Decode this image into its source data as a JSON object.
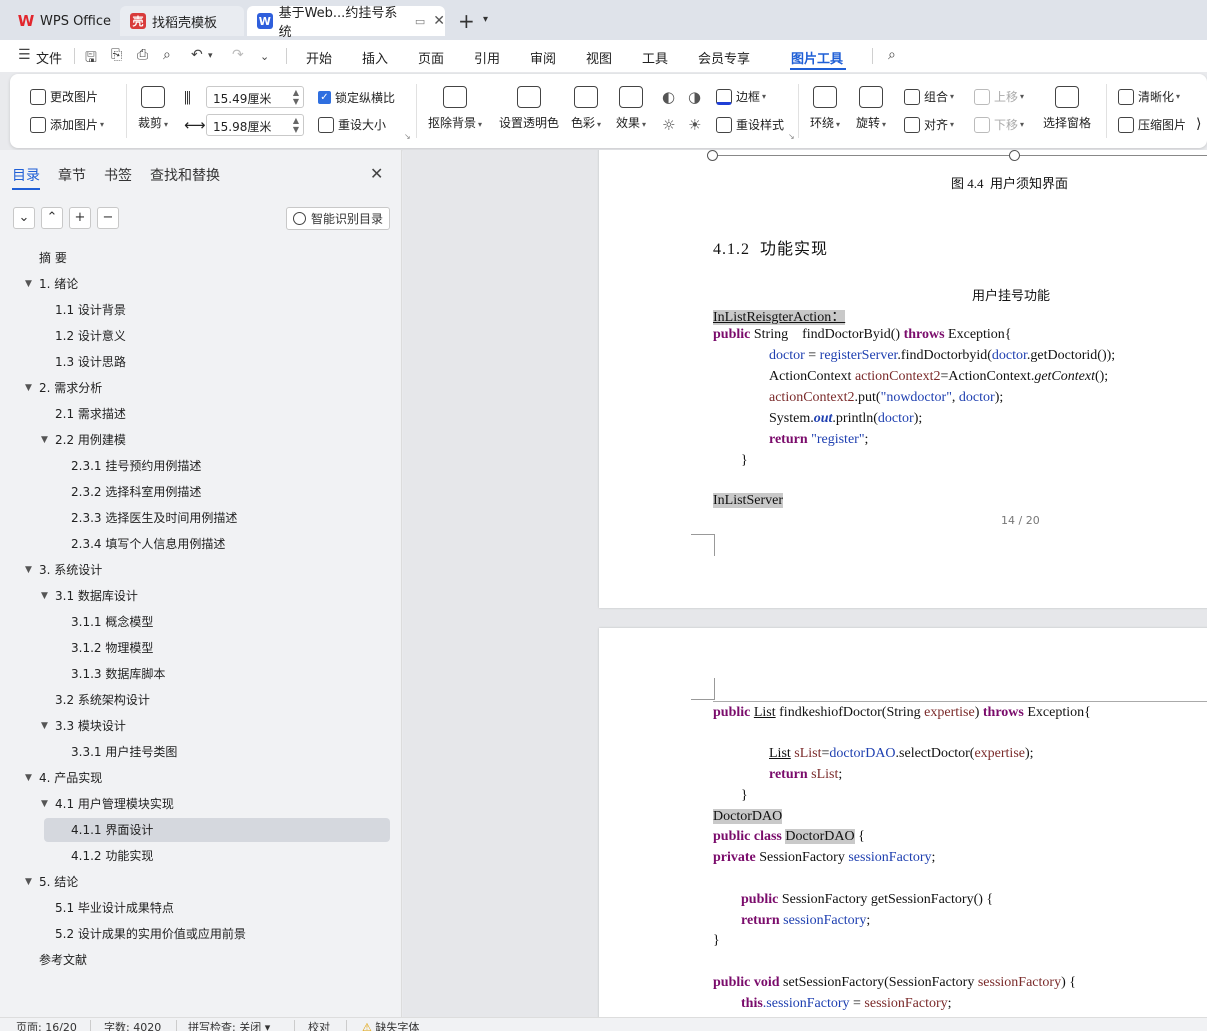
{
  "tabs": {
    "wps": "WPS Office",
    "template": "找稻壳模板",
    "document": "基于Web...约挂号系统"
  },
  "menu": {
    "file": "文件",
    "items": [
      "开始",
      "插入",
      "页面",
      "引用",
      "审阅",
      "视图",
      "工具",
      "会员专享",
      "图片工具"
    ],
    "active": "图片工具"
  },
  "ribbon": {
    "change_image": "更改图片",
    "add_image": "添加图片",
    "crop": "裁剪",
    "width_value": "15.49厘米",
    "height_value": "15.98厘米",
    "lock_ratio": "锁定纵横比",
    "reset_size": "重设大小",
    "remove_bg": "抠除背景",
    "set_transparent": "设置透明色",
    "color": "色彩",
    "effect": "效果",
    "border": "边框",
    "reset_style": "重设样式",
    "wrap": "环绕",
    "rotate": "旋转",
    "group": "组合",
    "align": "对齐",
    "move_up": "上移",
    "move_down": "下移",
    "selection_pane": "选择窗格",
    "sharpen": "清晰化",
    "compress": "压缩图片"
  },
  "nav_panel": {
    "tabs": [
      "目录",
      "章节",
      "书签",
      "查找和替换"
    ],
    "active_tab": "目录",
    "smart_toc": "智能识别目录",
    "toc": [
      {
        "text": "摘  要",
        "level": 0,
        "arrow": false
      },
      {
        "text": "1.  绪论",
        "level": 0,
        "arrow": true
      },
      {
        "text": "1.1 设计背景",
        "level": 1,
        "arrow": false
      },
      {
        "text": "1.2 设计意义",
        "level": 1,
        "arrow": false
      },
      {
        "text": "1.3 设计思路",
        "level": 1,
        "arrow": false
      },
      {
        "text": "2.  需求分析",
        "level": 0,
        "arrow": true
      },
      {
        "text": "2.1  需求描述",
        "level": 1,
        "arrow": false
      },
      {
        "text": "2.2  用例建模",
        "level": 1,
        "arrow": true
      },
      {
        "text": "2.3.1  挂号预约用例描述",
        "level": 2,
        "arrow": false
      },
      {
        "text": "2.3.2 选择科室用例描述",
        "level": 2,
        "arrow": false
      },
      {
        "text": "2.3.3  选择医生及时间用例描述",
        "level": 2,
        "arrow": false
      },
      {
        "text": "2.3.4  填写个人信息用例描述",
        "level": 2,
        "arrow": false
      },
      {
        "text": "3.  系统设计",
        "level": 0,
        "arrow": true
      },
      {
        "text": "3.1  数据库设计",
        "level": 1,
        "arrow": true
      },
      {
        "text": "3.1.1  概念模型",
        "level": 2,
        "arrow": false
      },
      {
        "text": "3.1.2  物理模型",
        "level": 2,
        "arrow": false
      },
      {
        "text": "3.1.3  数据库脚本",
        "level": 2,
        "arrow": false
      },
      {
        "text": "3.2  系统架构设计",
        "level": 1,
        "arrow": false
      },
      {
        "text": "3.3  模块设计",
        "level": 1,
        "arrow": true
      },
      {
        "text": "3.3.1 用户挂号类图",
        "level": 2,
        "arrow": false
      },
      {
        "text": "4.  产品实现",
        "level": 0,
        "arrow": true
      },
      {
        "text": "4.1  用户管理模块实现",
        "level": 1,
        "arrow": true
      },
      {
        "text": "4.1.1  界面设计",
        "level": 2,
        "arrow": false,
        "selected": true
      },
      {
        "text": "4.1.2  功能实现",
        "level": 2,
        "arrow": false
      },
      {
        "text": "5.  结论",
        "level": 0,
        "arrow": true
      },
      {
        "text": "5.1 毕业设计成果特点",
        "level": 1,
        "arrow": false
      },
      {
        "text": "5.2 设计成果的实用价值或应用前景",
        "level": 1,
        "arrow": false
      },
      {
        "text": "参考文献",
        "level": 0,
        "arrow": false
      }
    ]
  },
  "document": {
    "figure_caption": "图 4.4  用户须知界面",
    "section_heading": "4.1.2  功能实现",
    "subtitle": "用户挂号功能",
    "class_label_1": "InListReisgterAction：",
    "code1": {
      "l1_kw": "public",
      "l1_rest": " String    findDoctorByid() ",
      "l1_kw2": "throws",
      "l1_end": " Exception{",
      "l2_a": "doctor",
      "l2_b": " = ",
      "l2_c": "registerServer",
      "l2_d": ".findDoctorbyid(",
      "l2_e": "doctor",
      "l2_f": ".getDoctorid());",
      "l3_a": "ActionContext ",
      "l3_b": "actionContext2",
      "l3_c": "=ActionContext.",
      "l3_d": "getContext",
      "l3_e": "();",
      "l4_a": "actionContext2",
      "l4_b": ".put(",
      "l4_c": "\"nowdoctor\"",
      "l4_d": ", ",
      "l4_e": "doctor",
      "l4_f": ");",
      "l5_a": "System.",
      "l5_b": "out",
      "l5_c": ".println(",
      "l5_d": "doctor",
      "l5_e": ");",
      "l6_kw": "return",
      "l6_str": " \"register\"",
      "l6_end": ";",
      "l7": "}"
    },
    "class_label_2": "InListServer",
    "page_number": "14 / 20",
    "code2": {
      "a1_kw": "public",
      "a1_list": "List",
      "a1_rest": " findkeshiofDoctor(String ",
      "a1_var": "expertise",
      "a1_c": ") ",
      "a1_kw2": "throws",
      "a1_end": " Exception{",
      "a2_list": "List",
      "a2_var": " sList",
      "a2_b": "=",
      "a2_c": "doctorDAO",
      "a2_d": ".selectDoctor(",
      "a2_e": "expertise",
      "a2_f": ");",
      "a3_kw": "return",
      "a3_var": " sList",
      "a3_end": ";",
      "a4": "}",
      "dao_label": "DoctorDAO",
      "b1_kw": "public class",
      "b1_hl": "DoctorDAO",
      "b1_end": " {",
      "b2_kw": "private",
      "b2_rest": " SessionFactory ",
      "b2_fld": "sessionFactory",
      "b2_end": ";",
      "b3_kw": "public",
      "b3_rest": " SessionFactory getSessionFactory() {",
      "b4_kw": "return",
      "b4_fld": " sessionFactory",
      "b4_end": ";",
      "b5": "}",
      "b6_kw": "public void",
      "b6_rest": " setSessionFactory(SessionFactory ",
      "b6_var": "sessionFactory",
      "b6_end": ") {",
      "b7_kw": "this",
      "b7_fld": ".sessionFactory",
      "b7_b": " = ",
      "b7_var": "sessionFactory",
      "b7_end": ";"
    }
  },
  "statusbar": {
    "page": "页面: 16/20",
    "words": "字数: 4020",
    "spell": "拼写检查: 关闭",
    "proof": "校对",
    "missing_font": "缺失字体"
  },
  "colors": {
    "accent": "#1f5fd6",
    "keyword": "#7a0b6b",
    "field": "#1e3fb0",
    "highlight": "#c9c9c9"
  }
}
